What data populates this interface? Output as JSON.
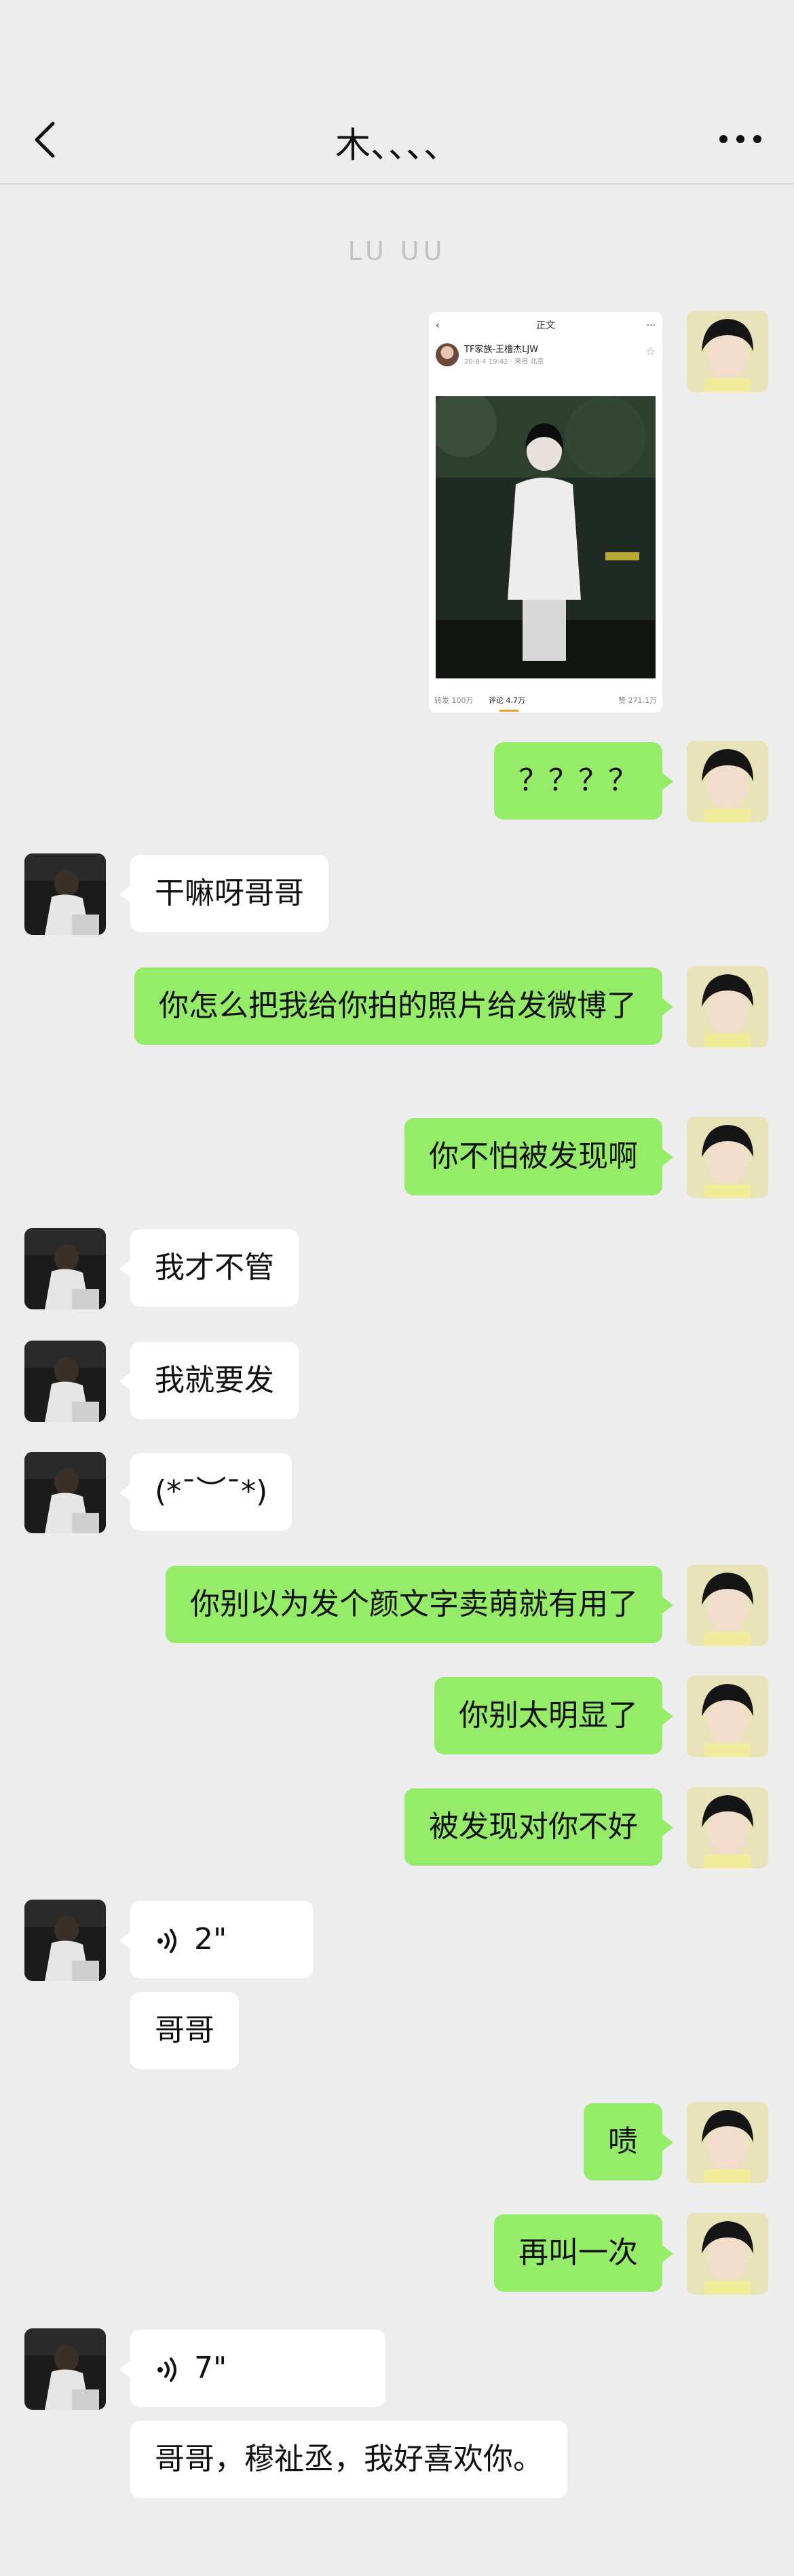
{
  "header": {
    "title": "木、、、、"
  },
  "chat": {
    "timestamp": "LU UU",
    "screenshot": {
      "topbar_title": "正文",
      "user_name": "TF家族-王橹杰LJW",
      "meta": "20-8-4 19:42 · 来自 北京",
      "footer": {
        "reposts": "转发 100万",
        "comments": "评论 4.7万",
        "likes": "赞 271.1万"
      }
    },
    "messages": [
      {
        "from": "me",
        "text": "？？？？"
      },
      {
        "from": "them",
        "text": "干嘛呀哥哥"
      },
      {
        "from": "me",
        "text": "你怎么把我给你拍的照片给发微博了"
      },
      {
        "from": "me",
        "text": "你不怕被发现啊"
      },
      {
        "from": "them",
        "text": "我才不管"
      },
      {
        "from": "them",
        "text": "我就要发"
      },
      {
        "from": "them",
        "text": "(*¯︶¯*)"
      },
      {
        "from": "me",
        "text": "你别以为发个颜文字卖萌就有用了"
      },
      {
        "from": "me",
        "text": "你别太明显了"
      },
      {
        "from": "me",
        "text": "被发现对你不好"
      },
      {
        "from": "them",
        "text": "2\""
      },
      {
        "from": "them",
        "text": "哥哥"
      },
      {
        "from": "me",
        "text": "啧"
      },
      {
        "from": "me",
        "text": "再叫一次"
      },
      {
        "from": "them",
        "text": "7\""
      },
      {
        "from": "them",
        "text": "哥哥，穆祉丞，我好喜欢你。"
      }
    ]
  },
  "colors": {
    "background": "#ededed",
    "my_bubble": "#95ec69",
    "their_bubble": "#ffffff"
  },
  "icons": {
    "back": "chevron-left-icon",
    "more": "more-dots-icon",
    "voice": "voice-wave-icon"
  }
}
